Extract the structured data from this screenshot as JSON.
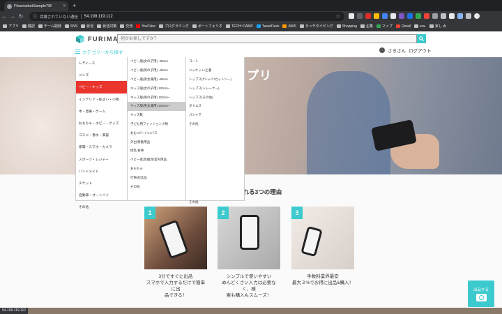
{
  "browser": {
    "tab_title": "FleamarketSample78f",
    "tab_close": "×",
    "new_tab": "+",
    "omnibox_warning": "保護されていない通信",
    "url": "54.199.119.112",
    "star": "☆",
    "bookmarks": [
      "アプリ",
      "翻訳",
      "チーム開発",
      "SNS",
      "就活",
      "就活対策",
      "交流",
      "YouTube",
      "プログラミング",
      "ポートフォリオ",
      "TECH::CAMP",
      "TweetDeck",
      "AWS",
      "タッチタイピング",
      "Shopping",
      "企業",
      "マップ",
      "Gmail",
      "era-",
      "家し 女"
    ],
    "status_url": "54.199.119.112"
  },
  "header": {
    "logo": "FURIMA",
    "search_placeholder": "何かお探しですか？",
    "category_link": "カテゴリーから探す",
    "username": "さきさん",
    "logout": "ログアウト"
  },
  "hero": {
    "text": "プリ"
  },
  "menu": {
    "level1": [
      "レディース",
      "メンズ",
      "ベビー・キッズ",
      "インテリア・住まい・小物",
      "本・音楽・ゲーム",
      "おもちゃ・ホビー・グッズ",
      "コスメ・香水・美容",
      "家電・スマホ・カメラ",
      "スポーツ・レジャー",
      "ハンドメイド",
      "チケット",
      "自動車・オートバイ",
      "その他"
    ],
    "level1_active": 2,
    "level2": [
      "ベビー服(女の子用) ~95cm",
      "ベビー服(男の子用) ~95cm",
      "ベビー服(男女兼用) ~95cm",
      "キッズ服(女の子用) 100cm~",
      "キッズ服(男の子用) 100cm~",
      "キッズ服(男女兼用) 100cm~",
      "キッズ靴",
      "子ども用ファッション小物",
      "おむつ/トイレ/バス",
      "外出/移動用品",
      "授乳/食事",
      "ベビー家具/寝具/室内用品",
      "おもちゃ",
      "行事/記念品",
      "その他"
    ],
    "level2_hover": 5,
    "level3": [
      "コート",
      "ジャケット/上着",
      "トップス(Tシャツ/カットソー)",
      "トップス(トレーナー)",
      "トップス(その他)",
      "ボトムス",
      "パジャマ",
      "その他"
    ],
    "level3_extra": "その他"
  },
  "reasons": {
    "title": "ばれる3つの理由",
    "cards": [
      {
        "num": "1",
        "line1": "3分ですぐに出品",
        "line2": "スマホで入力するだけで簡単に出",
        "line3": "品できる！"
      },
      {
        "num": "2",
        "line1": "シンプルで使いやすい",
        "line2": "めんどくさい入力は必要なく、検",
        "line3": "索も購入もスムーズ！"
      },
      {
        "num": "3",
        "line1": "手数料業界最安",
        "line2": "最大３%でお得に出品&購入！",
        "line3": ""
      }
    ]
  },
  "sell_button": {
    "label": "出品する"
  },
  "colors": {
    "accent": "#3ccace",
    "active": "#ea352d"
  }
}
